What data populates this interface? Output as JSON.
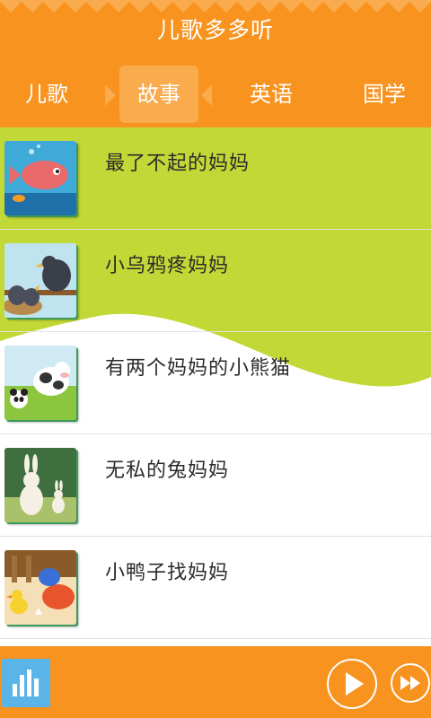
{
  "app": {
    "title": "儿歌多多听"
  },
  "tabs": [
    {
      "label": "儿歌",
      "active": false
    },
    {
      "label": "故事",
      "active": true
    },
    {
      "label": "英语",
      "active": false
    },
    {
      "label": "国学",
      "active": false
    }
  ],
  "stories": [
    {
      "title": "最了不起的妈妈",
      "thumb": "fish-illustration"
    },
    {
      "title": "小乌鸦疼妈妈",
      "thumb": "crows-illustration"
    },
    {
      "title": "有两个妈妈的小熊猫",
      "thumb": "panda-cow-illustration"
    },
    {
      "title": "无私的兔妈妈",
      "thumb": "rabbits-illustration"
    },
    {
      "title": "小鸭子找妈妈",
      "thumb": "duckling-illustration"
    }
  ],
  "colors": {
    "header": "#f7931e",
    "active_tab": "#f9ab4e",
    "wave": "#c2d836",
    "playlist_button": "#5ab4e8"
  },
  "player": {
    "playlist_icon": "equalizer-icon",
    "play_icon": "play-icon",
    "next_icon": "fast-forward-icon"
  }
}
